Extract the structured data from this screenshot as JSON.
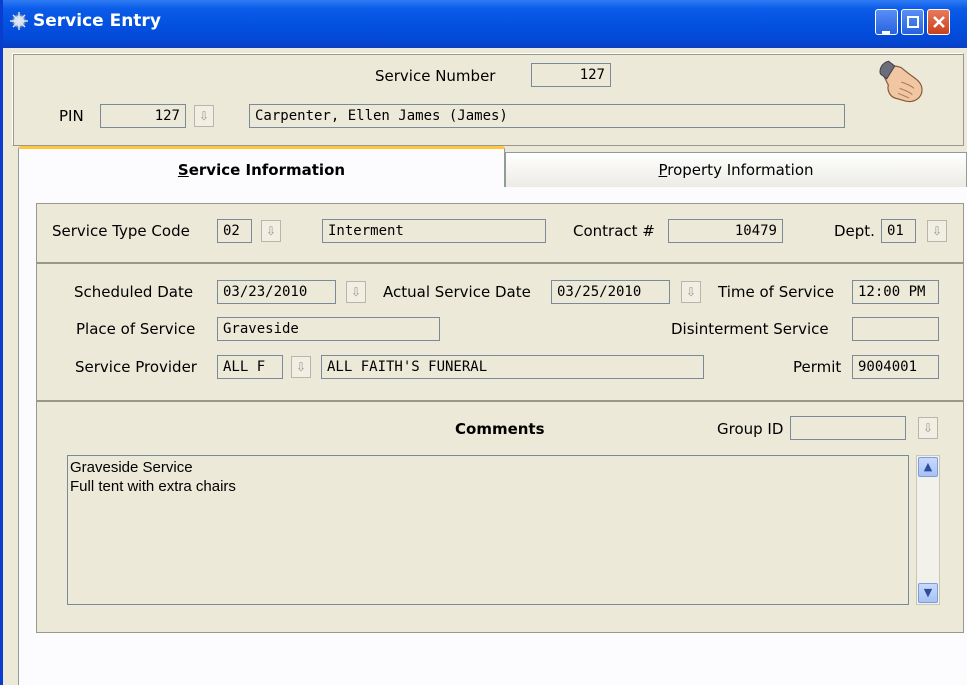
{
  "window": {
    "title": "Service Entry"
  },
  "header": {
    "service_number_label": "Service Number",
    "service_number_value": "127",
    "pin_label": "PIN",
    "pin_value": "127",
    "name_value": "Carpenter, Ellen James (James)"
  },
  "tabs": [
    {
      "label": "Service Information",
      "active": true
    },
    {
      "label": "Property Information",
      "active": false
    }
  ],
  "service_type": {
    "code_label": "Service Type Code",
    "code_value": "02",
    "description": "Interment",
    "contract_label": "Contract #",
    "contract_value": "10479",
    "dept_label": "Dept.",
    "dept_value": "01"
  },
  "details": {
    "scheduled_date_label": "Scheduled Date",
    "scheduled_date_value": "03/23/2010",
    "actual_date_label": "Actual Service Date",
    "actual_date_value": "03/25/2010",
    "time_label": "Time of Service",
    "time_value": "12:00 PM",
    "place_label": "Place of Service",
    "place_value": "Graveside",
    "disinterment_label": "Disinterment Service",
    "disinterment_value": "",
    "provider_label": "Service Provider",
    "provider_code": "ALL F",
    "provider_name": "ALL FAITH'S FUNERAL",
    "permit_label": "Permit",
    "permit_value": "9004001"
  },
  "comments": {
    "label": "Comments",
    "group_id_label": "Group ID",
    "group_id_value": "",
    "lines": [
      "Graveside Service",
      "Full tent with extra chairs"
    ]
  },
  "colors": {
    "titlebar": "#0453e1",
    "window_bg": "#ece9d8",
    "tab_accent": "#ffc73c"
  },
  "icons": [
    "app-icon",
    "minimize-icon",
    "maximize-icon",
    "close-icon",
    "dropdown-arrow-icon",
    "hand-icon",
    "scroll-up-icon",
    "scroll-down-icon"
  ]
}
